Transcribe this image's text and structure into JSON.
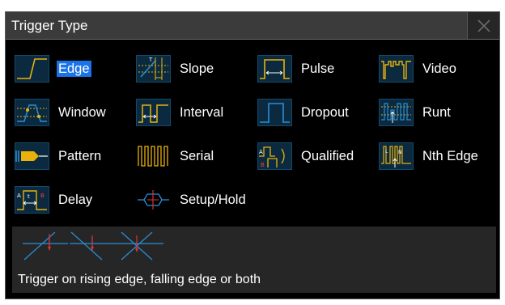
{
  "dialog": {
    "title": "Trigger Type",
    "close_icon": "close-icon",
    "selected": "Edge",
    "accent_color": "#1a73e8",
    "icon_color": "#e8b10c",
    "waveform_color": "#2a8fd6"
  },
  "trigger_types": [
    {
      "id": "edge",
      "label": "Edge",
      "icon": "edge-icon"
    },
    {
      "id": "slope",
      "label": "Slope",
      "icon": "slope-icon"
    },
    {
      "id": "pulse",
      "label": "Pulse",
      "icon": "pulse-icon"
    },
    {
      "id": "video",
      "label": "Video",
      "icon": "video-icon"
    },
    {
      "id": "window",
      "label": "Window",
      "icon": "window-icon"
    },
    {
      "id": "interval",
      "label": "Interval",
      "icon": "interval-icon"
    },
    {
      "id": "dropout",
      "label": "Dropout",
      "icon": "dropout-icon"
    },
    {
      "id": "runt",
      "label": "Runt",
      "icon": "runt-icon"
    },
    {
      "id": "pattern",
      "label": "Pattern",
      "icon": "pattern-icon"
    },
    {
      "id": "serial",
      "label": "Serial",
      "icon": "serial-icon"
    },
    {
      "id": "qualified",
      "label": "Qualified",
      "icon": "qualified-icon"
    },
    {
      "id": "nth_edge",
      "label": "Nth Edge",
      "icon": "nth-edge-icon"
    },
    {
      "id": "delay",
      "label": "Delay",
      "icon": "delay-icon"
    },
    {
      "id": "setup_hold",
      "label": "Setup/Hold",
      "icon": "setup-hold-icon"
    }
  ],
  "preview": {
    "icon": "edge-diagram-icon",
    "description": "Trigger on rising edge, falling edge or both"
  }
}
